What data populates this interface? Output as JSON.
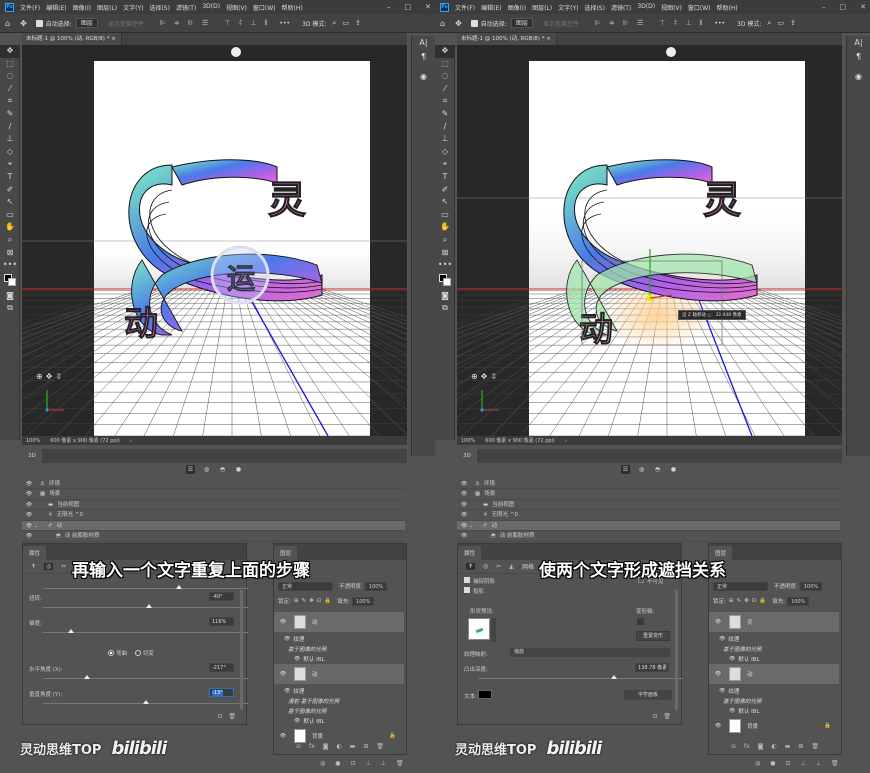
{
  "app": {
    "logo": "Ps",
    "menu": [
      "文件(F)",
      "编辑(E)",
      "图像(I)",
      "图层(L)",
      "文字(Y)",
      "选择(S)",
      "滤镜(T)",
      "3D(D)",
      "视图(V)",
      "窗口(W)",
      "帮助(H)"
    ],
    "window_controls": [
      "–",
      "□",
      "✕"
    ]
  },
  "options_bar": {
    "home_icon": "⌂",
    "move_icon": "✥",
    "auto_select_label": "自动选择:",
    "auto_select_value": "图层",
    "show_transform_label": "显示变换控件",
    "more": "•••",
    "mode_3d_label": "3D 模式:"
  },
  "document": {
    "tab_title": "未标题-1 @ 100% (动, RGB/8) *",
    "zoom": "100%",
    "size_info": "600 像素 x 900 像素 (72 ppi)",
    "arrow": "›"
  },
  "tools": [
    "✥",
    "⬚",
    "◌",
    "⁄",
    "⌗",
    "✎",
    "/",
    "⊥",
    "◇",
    "⌖",
    "T",
    "✐",
    "↖",
    "▭",
    "✋",
    "⌕",
    "⊠",
    "•••"
  ],
  "right_panel_icons": [
    "A|",
    "¶",
    "◉"
  ],
  "panel_3d": {
    "tab": "3D",
    "filter_icons": [
      "☰",
      "◍",
      "◓",
      "●"
    ],
    "rows": [
      {
        "label": "环境",
        "icon": "⚓",
        "indent": 0,
        "selected": false
      },
      {
        "label": "场景",
        "icon": "▦",
        "indent": 0,
        "selected": false
      },
      {
        "label": "当前视图",
        "icon": "▬",
        "indent": 1,
        "selected": false
      },
      {
        "label": "无限光 ^0",
        "icon": "✳",
        "indent": 1,
        "selected": false
      },
      {
        "label": "动",
        "icon": "✐",
        "indent": 1,
        "selected": true,
        "expand": "⌄"
      },
      {
        "label": "动 前膨胀材质",
        "icon": "◓",
        "indent": 2,
        "selected": false
      }
    ]
  },
  "left_screen": {
    "caption": "再输入一个文字重复上面的步骤",
    "properties": {
      "tab": "属性",
      "icons": [
        "↟",
        "◎",
        "✂",
        "◭"
      ],
      "rows": [
        {
          "label": "扭转:",
          "value": "-40°",
          "slider": 0.5
        },
        {
          "label": "锥度:",
          "value": "116%",
          "slider": 0.12
        },
        {
          "label": "水平角度 (X):",
          "value": "-217°",
          "slider": 0.2
        },
        {
          "label": "垂直角度 (Y):",
          "value": "-13°",
          "slider": 0.49,
          "highlight": true
        }
      ],
      "top_slider": 0.65,
      "radio": [
        {
          "label": "弯曲",
          "checked": true
        },
        {
          "label": "切变",
          "checked": false
        }
      ]
    },
    "layers": {
      "tab": "图层",
      "blend_mode": "正常",
      "opacity_label": "不透明度:",
      "opacity": "100%",
      "lock_label": "锁定:",
      "fill_label": "填充:",
      "fill": "100%",
      "items": [
        {
          "name": "动",
          "type": "3d"
        },
        {
          "name": "纹理",
          "type": "sub"
        },
        {
          "name": "基于图像的光照",
          "type": "subitalic"
        },
        {
          "name": "默认 IBL",
          "type": "subsub"
        },
        {
          "name": "动",
          "type": "3d-drag"
        },
        {
          "name": "纹理",
          "type": "sub"
        },
        {
          "name": "漫射 基于图像的光照",
          "type": "subitalic"
        },
        {
          "name": "基于图像的光照",
          "type": "subitalic"
        },
        {
          "name": "默认 IBL",
          "type": "subsub"
        },
        {
          "name": "背景",
          "type": "bg"
        }
      ]
    }
  },
  "right_screen": {
    "caption": "使两个文字形成遮挡关系",
    "tooltip": "沿 Z 轴移动 △：32.448 像素",
    "properties": {
      "tab": "属性",
      "icons": [
        "↟",
        "◎",
        "✂",
        "◭"
      ],
      "mesh_label": "网格",
      "catch_shadows": "捕捉阴影",
      "cast_shadows": "投影",
      "invisible": "不可见",
      "shape_preset_label": "形状预设:",
      "deform_axis_label": "变形轴:",
      "reset_deform": "重置变形",
      "texture_map_label": "纹理映射:",
      "texture_map_value": "缩放",
      "extrusion_label": "凸出深度:",
      "extrusion_value": "138.78 像素",
      "extrusion_slider": 0.65,
      "text_label": "文本:",
      "text_color": "#000000",
      "char_panel": "字符面板"
    },
    "layers": {
      "tab": "图层",
      "blend_mode": "正常",
      "opacity_label": "不透明度:",
      "opacity": "100%",
      "lock_label": "锁定:",
      "fill_label": "填充:",
      "fill": "100%",
      "items": [
        {
          "name": "灵",
          "type": "3d"
        },
        {
          "name": "纹理",
          "type": "sub"
        },
        {
          "name": "基于图像的光照",
          "type": "subitalic"
        },
        {
          "name": "默认 IBL",
          "type": "subsub"
        },
        {
          "name": "动",
          "type": "3d-sel"
        },
        {
          "name": "纹理",
          "type": "sub"
        },
        {
          "name": "基于图像的光照",
          "type": "subitalic"
        },
        {
          "name": "默认 IBL",
          "type": "subsub"
        },
        {
          "name": "背景",
          "type": "bg"
        }
      ]
    }
  },
  "watermark": {
    "channel": "灵动思维TOP",
    "logo": "bilibili"
  },
  "art": {
    "char_top": "灵",
    "char_bottom": "动",
    "char_ghost": "运",
    "axis_red": "#e02020",
    "axis_blue": "#1515e0"
  }
}
